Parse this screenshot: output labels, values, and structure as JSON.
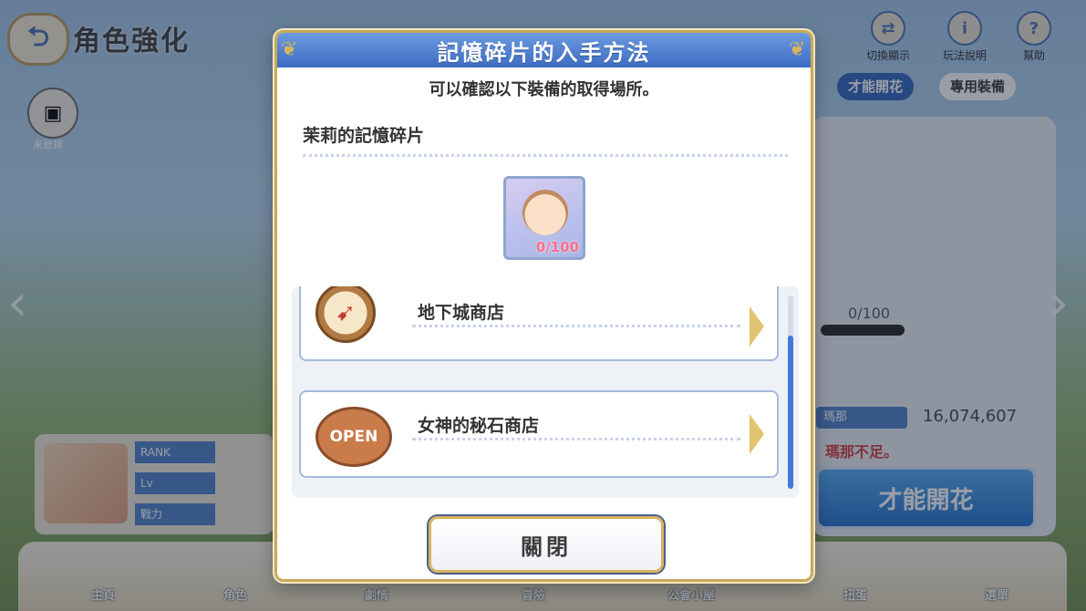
{
  "background": {
    "page_title": "角色強化",
    "top_icons": [
      "切換顯示",
      "玩法說明",
      "幫助"
    ],
    "side_button": "未登錄",
    "right_tabs": [
      "才能開花",
      "專用裝備"
    ],
    "fragment_count": "0/100",
    "money_label": "瑪那",
    "money_value": "16,074,607",
    "warning": "瑪那不足。",
    "bloom_button": "才能開花",
    "stat_labels": [
      "RANK",
      "Lv",
      "戰力"
    ],
    "nav_items": [
      "主頁",
      "角色",
      "劇情",
      "冒險",
      "公會小屋",
      "扭蛋",
      "選單"
    ]
  },
  "modal": {
    "title": "記憶碎片的入手方法",
    "subtitle": "可以確認以下裝備的取得場所。",
    "item_name": "茉莉的記憶碎片",
    "item_count": "0/100",
    "sources": [
      {
        "label": "地下城商店",
        "icon": "compass-map-icon"
      },
      {
        "label": "女神的秘石商店",
        "icon": "open-sign-icon",
        "icon_text": "OPEN"
      }
    ],
    "close_label": "關閉"
  },
  "colors": {
    "header_blue": "#3c6cc3",
    "gold_border": "#c9a95a",
    "count_pink": "#ff6b8a",
    "scroll_blue": "#3d7bd8"
  }
}
